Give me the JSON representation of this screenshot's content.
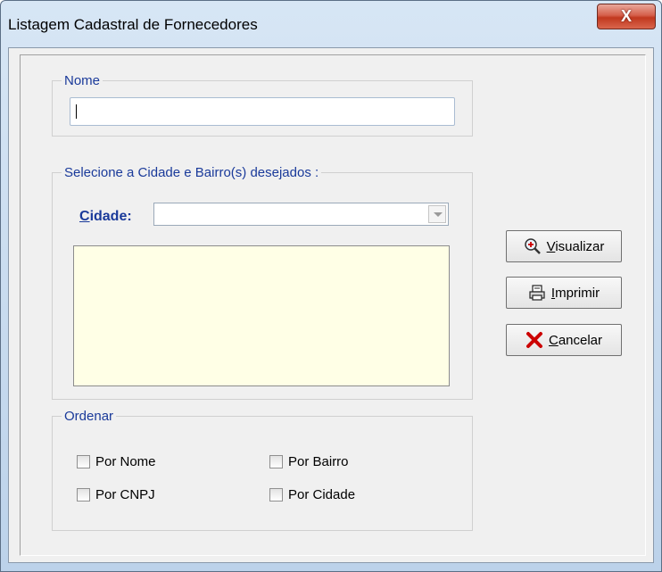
{
  "window": {
    "title": "Listagem Cadastral de Fornecedores",
    "close_glyph": "X"
  },
  "nome_group": {
    "legend": "Nome",
    "value": ""
  },
  "cidade_group": {
    "legend": "Selecione a Cidade e Bairro(s) desejados :",
    "cidade_accel": "C",
    "cidade_rest": "idade:",
    "selected": ""
  },
  "ordenar_group": {
    "legend": "Ordenar",
    "options": [
      {
        "label": "Por Nome",
        "checked": false
      },
      {
        "label": "Por Bairro",
        "checked": false
      },
      {
        "label": "Por CNPJ",
        "checked": false
      },
      {
        "label": "Por Cidade",
        "checked": false
      }
    ]
  },
  "buttons": {
    "visualizar": {
      "accel": "V",
      "rest": "isualizar",
      "icon": "zoom-in-icon"
    },
    "imprimir": {
      "accel": "I",
      "rest": "mprimir",
      "icon": "printer-icon"
    },
    "cancelar": {
      "accel": "C",
      "rest": "ancelar",
      "icon": "red-x-icon",
      "color": "#cc0000"
    }
  }
}
